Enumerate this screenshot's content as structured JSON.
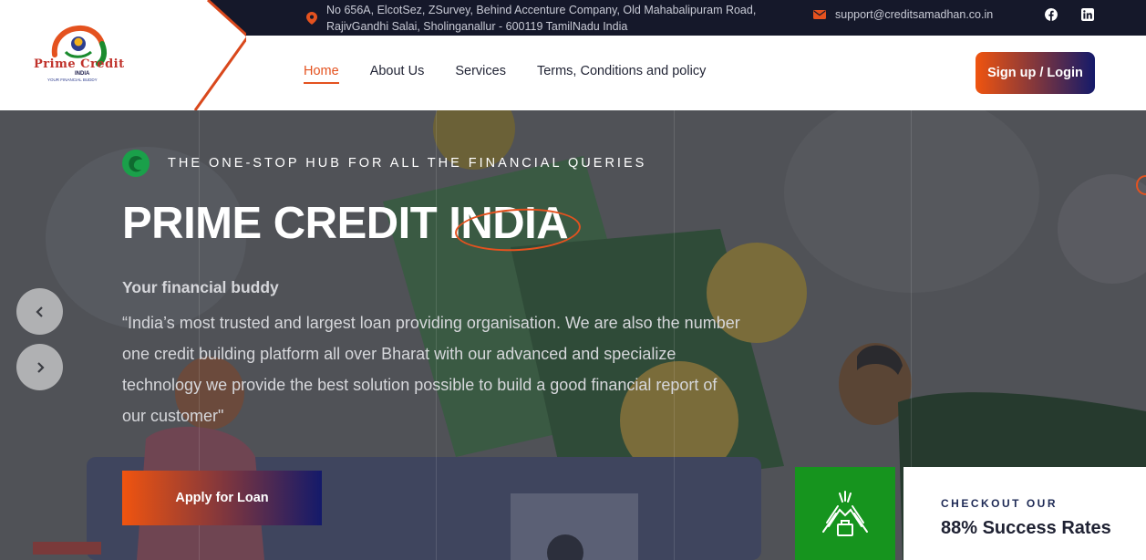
{
  "topbar": {
    "address_line1": "No 656A, ElcotSez, ZSurvey, Behind Accenture Company, Old Mahabalipuram Road,",
    "address_line2": "RajivGandhi Salai, Sholinganallur - 600119 TamilNadu India",
    "email": "support@creditsamadhan.co.in",
    "icons": {
      "address": "location-pin-icon",
      "email": "envelope-icon",
      "facebook": "facebook-icon",
      "linkedin": "linkedin-icon"
    }
  },
  "logo": {
    "name": "Prime Credit",
    "sub": "INDIA",
    "tagline": "YOUR FINANCIAL BUDDY"
  },
  "nav": {
    "items": [
      {
        "label": "Home",
        "active": true
      },
      {
        "label": "About Us"
      },
      {
        "label": "Services"
      },
      {
        "label": "Terms, Conditions and policy"
      }
    ],
    "cta": "Sign up / Login"
  },
  "hero": {
    "tagline": "THE ONE-STOP HUB FOR ALL THE FINANCIAL QUERIES",
    "title": "PRIME CREDIT INDIA",
    "subtitle": "Your financial buddy",
    "description": "“India’s most trusted and largest loan providing organisation. We are also the number one credit building platform all over Bharat with our advanced and specialize technology we provide the best solution possible to build a good financial report of our customer\"",
    "apply_button": "Apply for Loan",
    "prev_arrow": "‹",
    "next_arrow": "›"
  },
  "success": {
    "kicker": "CHECKOUT OUR",
    "stat": "88% Success Rates"
  },
  "colors": {
    "accent": "#e4521f",
    "gradient_start": "#f0540f",
    "gradient_end": "#141a6a",
    "dark": "#15182a",
    "green": "#16941e"
  }
}
